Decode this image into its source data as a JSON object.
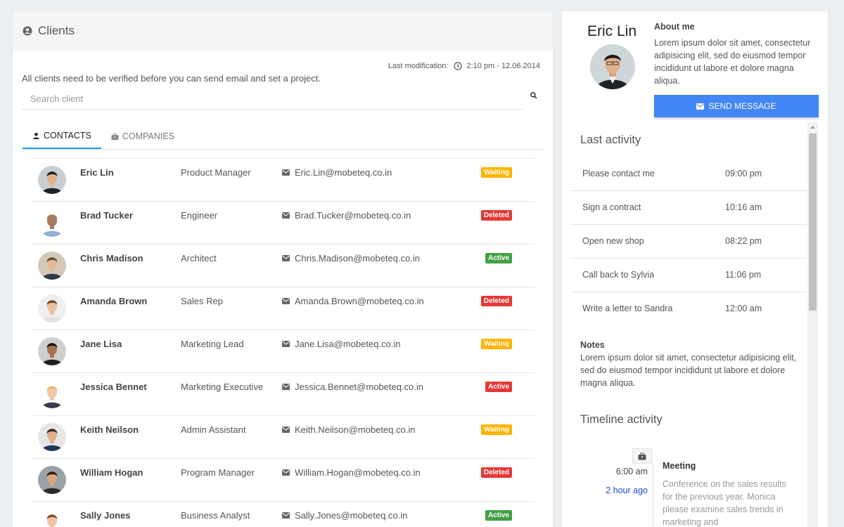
{
  "clients_panel": {
    "title": "Clients",
    "last_modification_label": "Last modification:",
    "last_modification_value": "2:10 pm - 12.06.2014",
    "notice": "All clients need to be verified before you can send email and set a project.",
    "search_placeholder": "Search client",
    "tabs": [
      {
        "label": "CONTACTS",
        "icon": "person-icon",
        "active": true
      },
      {
        "label": "COMPANIES",
        "icon": "briefcase-icon",
        "active": false
      }
    ],
    "contacts": [
      {
        "name": "Eric Lin",
        "role": "Product Manager",
        "email": "Eric.Lin@mobeteq.co.in",
        "status": "Waiting",
        "status_type": "waiting"
      },
      {
        "name": "Brad Tucker",
        "role": "Engineer",
        "email": "Brad.Tucker@mobeteq.co.in",
        "status": "Deleted",
        "status_type": "deleted"
      },
      {
        "name": "Chris Madison",
        "role": "Architect",
        "email": "Chris.Madison@mobeteq.co.in",
        "status": "Active",
        "status_type": "active"
      },
      {
        "name": "Amanda Brown",
        "role": "Sales Rep",
        "email": "Amanda.Brown@mobeteq.co.in",
        "status": "Deleted",
        "status_type": "deleted"
      },
      {
        "name": "Jane Lisa",
        "role": "Marketing Lead",
        "email": "Jane.Lisa@mobeteq.co.in",
        "status": "Waiting",
        "status_type": "waiting"
      },
      {
        "name": "Jessica Bennet",
        "role": "Marketing Executive",
        "email": "Jessica.Bennet@mobeteq.co.in",
        "status": "Active",
        "status_type": "deleted"
      },
      {
        "name": "Keith Neilson",
        "role": "Admin Assistant",
        "email": "Keith.Neilson@mobeteq.co.in",
        "status": "Waiting",
        "status_type": "waiting"
      },
      {
        "name": "William Hogan",
        "role": "Program Manager",
        "email": "William.Hogan@mobeteq.co.in",
        "status": "Deleted",
        "status_type": "deleted"
      },
      {
        "name": "Sally Jones",
        "role": "Business Analyst",
        "email": "Sally.Jones@mobeteq.co.in",
        "status": "Active",
        "status_type": "active"
      }
    ]
  },
  "profile": {
    "name": "Eric Lin",
    "about_title": "About me",
    "about_text": "Lorem ipsum dolor sit amet, consectetur adipisicing elit, sed do eiusmod tempor incididunt ut labore et dolore magna aliqua.",
    "send_button": "SEND MESSAGE",
    "last_activity_title": "Last activity",
    "activities": [
      {
        "label": "Please contact me",
        "time": "09:00 pm"
      },
      {
        "label": "Sign a contract",
        "time": "10:16 am"
      },
      {
        "label": "Open new shop",
        "time": "08:22 pm"
      },
      {
        "label": "Call back to Sylvia",
        "time": "11:06 pm"
      },
      {
        "label": "Write a letter to Sandra",
        "time": "12:00 am"
      }
    ],
    "notes_title": "Notes",
    "notes_text": "Lorem ipsum dolor sit amet, consectetur adipisicing elit, sed do eiusmod tempor incididunt ut labore et dolore magna aliqua.",
    "timeline_title": "Timeline activity",
    "timeline": [
      {
        "time": "6:00 am",
        "ago": "2 hour ago",
        "title": "Meeting",
        "text": "Conference on the sales results for the previous year. Monica please examine sales trends in marketing and",
        "icon": "briefcase-icon"
      }
    ]
  },
  "colors": {
    "accent": "#2196f3",
    "button": "#4285f4",
    "waiting": "#ffb300",
    "deleted": "#e53935",
    "active": "#43a047",
    "link": "#1e4bd3"
  }
}
